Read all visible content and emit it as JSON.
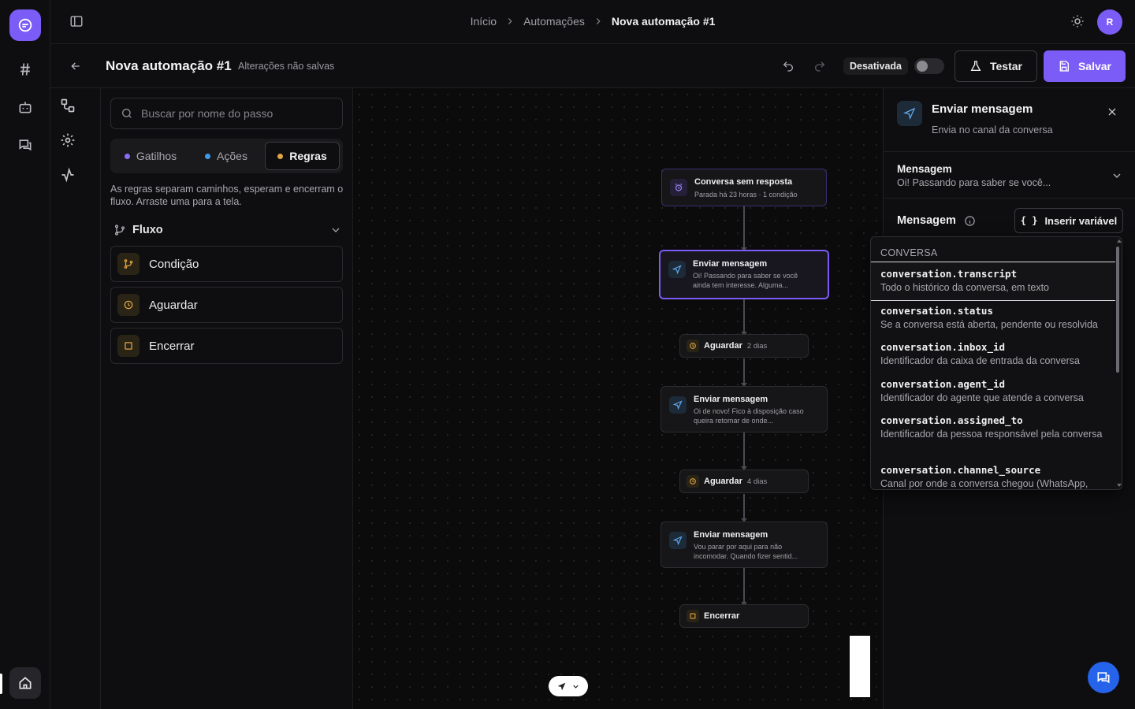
{
  "header": {
    "breadcrumbs": [
      "Início",
      "Automações",
      "Nova automação #1"
    ],
    "avatar_initial": "R"
  },
  "subheader": {
    "title": "Nova automação #1",
    "unsaved_note": "Alterações não salvas",
    "status_label": "Desativada",
    "status_active": false,
    "test_label": "Testar",
    "save_label": "Salvar"
  },
  "library": {
    "search_placeholder": "Buscar por nome do passo",
    "tabs": [
      {
        "label": "Gatilhos",
        "color": "#8b6cf6",
        "active": false
      },
      {
        "label": "Ações",
        "color": "#3b9bea",
        "active": false
      },
      {
        "label": "Regras",
        "color": "#e0a440",
        "active": true
      }
    ],
    "hint": "As regras separam caminhos, esperam e encerram o fluxo. Arraste uma para a tela.",
    "group_label": "Fluxo",
    "items": [
      {
        "label": "Condição",
        "icon": "branch-icon"
      },
      {
        "label": "Aguardar",
        "icon": "clock-icon"
      },
      {
        "label": "Encerrar",
        "icon": "stop-square-icon"
      }
    ]
  },
  "flow": {
    "trigger": {
      "title": "Conversa sem resposta",
      "subtitle": "Parada há 23 horas · 1 condição"
    },
    "send1": {
      "title": "Enviar mensagem",
      "subtitle": "Oi! Passando para saber se você ainda tem interesse. Alguma..."
    },
    "wait1": {
      "title": "Aguardar",
      "meta": "2 dias"
    },
    "send2": {
      "title": "Enviar mensagem",
      "subtitle": "Oi de novo! Fico à disposição caso queira retomar de onde..."
    },
    "wait2": {
      "title": "Aguardar",
      "meta": "4 dias"
    },
    "send3": {
      "title": "Enviar mensagem",
      "subtitle": "Vou parar por aqui para não incomodar. Quando fizer sentid..."
    },
    "end": {
      "title": "Encerrar"
    }
  },
  "inspector": {
    "title": "Enviar mensagem",
    "subtitle": "Envia no canal da conversa",
    "section_title": "Mensagem",
    "section_preview": "Oi! Passando para saber se você...",
    "field_label": "Mensagem",
    "insert_variable_label": "Inserir variável"
  },
  "variables": {
    "group": "CONVERSA",
    "items": [
      {
        "key": "conversation.transcript",
        "desc": "Todo o histórico da conversa, em texto"
      },
      {
        "key": "conversation.status",
        "desc": "Se a conversa está aberta, pendente ou resolvida"
      },
      {
        "key": "conversation.inbox_id",
        "desc": "Identificador da caixa de entrada da conversa"
      },
      {
        "key": "conversation.agent_id",
        "desc": "Identificador do agente que atende a conversa"
      },
      {
        "key": "conversation.assigned_to",
        "desc": "Identificador da pessoa responsável pela conversa"
      },
      {
        "key": "conversation.channel_source",
        "desc": "Canal por onde a conversa chegou (WhatsApp,"
      }
    ]
  },
  "colors": {
    "accent": "#7c5cf6",
    "action": "#3b9bea",
    "rule": "#e0a440",
    "fab": "#2563eb"
  }
}
